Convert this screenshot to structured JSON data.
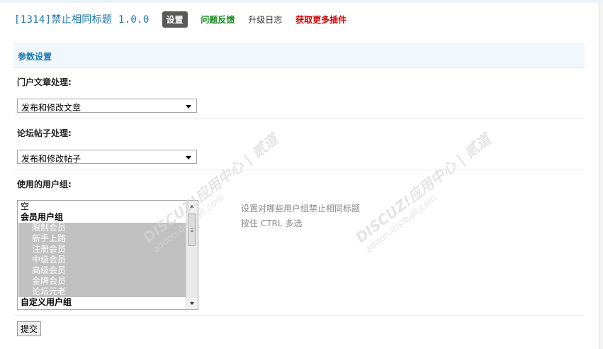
{
  "header": {
    "title": "[1314]禁止相同标题 1.0.0",
    "nav": {
      "settings": "设置",
      "feedback": "问题反馈",
      "changelog": "升级日志",
      "more_plugins": "获取更多插件"
    }
  },
  "section": {
    "title": "参数设置"
  },
  "portal": {
    "label": "门户文章处理:",
    "value": "发布和修改文章"
  },
  "forum": {
    "label": "论坛帖子处理:",
    "value": "发布和修改帖子"
  },
  "groups": {
    "label": "使用的用户组:",
    "options": [
      {
        "text": "空",
        "kind": "item",
        "selected": false
      },
      {
        "text": "会员用户组",
        "kind": "group",
        "selected": false
      },
      {
        "text": "限制会员",
        "kind": "child",
        "selected": true
      },
      {
        "text": "新手上路",
        "kind": "child",
        "selected": true
      },
      {
        "text": "注册会员",
        "kind": "child",
        "selected": true
      },
      {
        "text": "中级会员",
        "kind": "child",
        "selected": true
      },
      {
        "text": "高级会员",
        "kind": "child",
        "selected": true
      },
      {
        "text": "金牌会员",
        "kind": "child",
        "selected": true
      },
      {
        "text": "论坛元老",
        "kind": "child",
        "selected": true
      },
      {
        "text": "自定义用户组",
        "kind": "group",
        "selected": false
      }
    ],
    "tip_line1": "设置对哪些用户组禁止相同标题",
    "tip_line2": "按住 CTRL 多选"
  },
  "submit": {
    "label": "提交"
  },
  "watermark": {
    "brand": "DISCUZ!应用中心 | 贰道",
    "url": "addon.dismall.com"
  },
  "colors": {
    "title": "#1b75a8",
    "feedback": "#0e8a19",
    "more": "#d60000",
    "section_bg": "#f0f7fd"
  }
}
